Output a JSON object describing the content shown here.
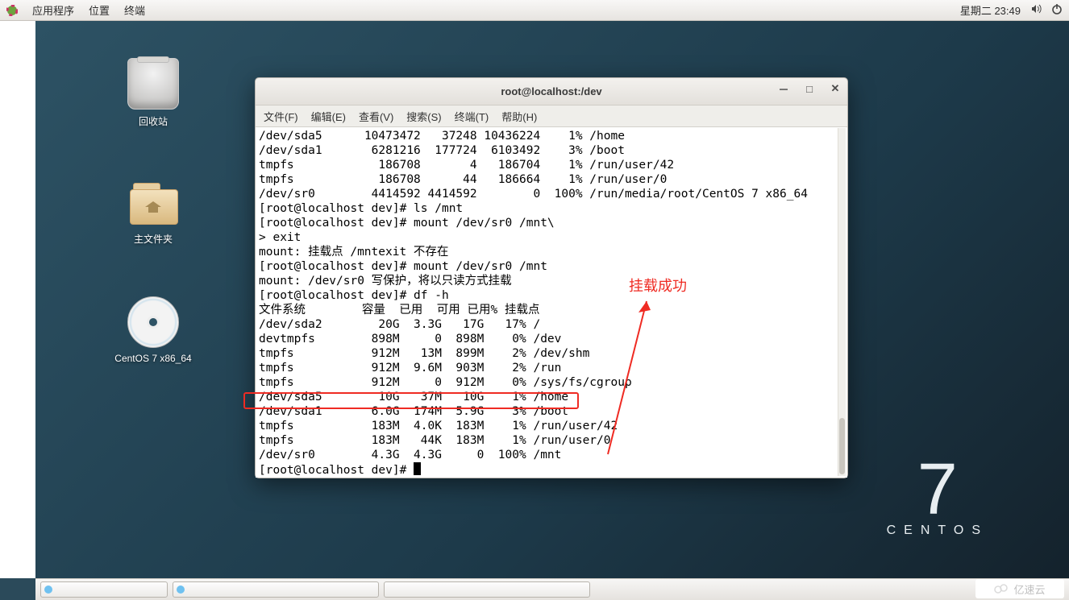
{
  "panel": {
    "apps": "应用程序",
    "places": "位置",
    "terminal": "终端",
    "clock": "星期二 23:49"
  },
  "desktop": {
    "trash": "回收站",
    "home": "主文件夹",
    "cd": "CentOS 7 x86_64"
  },
  "brand": {
    "num": "7",
    "word": "CENTOS"
  },
  "window": {
    "title": "root@localhost:/dev",
    "menu": {
      "file": "文件(F)",
      "edit": "编辑(E)",
      "view": "查看(V)",
      "search": "搜索(S)",
      "terminal": "终端(T)",
      "help": "帮助(H)"
    }
  },
  "terminal_lines": [
    "/dev/sda5      10473472   37248 10436224    1% /home",
    "/dev/sda1       6281216  177724  6103492    3% /boot",
    "tmpfs            186708       4   186704    1% /run/user/42",
    "tmpfs            186708      44   186664    1% /run/user/0",
    "/dev/sr0        4414592 4414592        0  100% /run/media/root/CentOS 7 x86_64",
    "[root@localhost dev]# ls /mnt",
    "[root@localhost dev]# mount /dev/sr0 /mnt\\",
    "> exit",
    "mount: 挂载点 /mntexit 不存在",
    "[root@localhost dev]# mount /dev/sr0 /mnt",
    "mount: /dev/sr0 写保护，将以只读方式挂载",
    "[root@localhost dev]# df -h",
    "文件系统        容量  已用  可用 已用% 挂载点",
    "/dev/sda2        20G  3.3G   17G   17% /",
    "devtmpfs        898M     0  898M    0% /dev",
    "tmpfs           912M   13M  899M    2% /dev/shm",
    "tmpfs           912M  9.6M  903M    2% /run",
    "tmpfs           912M     0  912M    0% /sys/fs/cgroup",
    "/dev/sda5        10G   37M   10G    1% /home",
    "/dev/sda1       6.0G  174M  5.9G    3% /boot",
    "tmpfs           183M  4.0K  183M    1% /run/user/42",
    "tmpfs           183M   44K  183M    1% /run/user/0",
    "/dev/sr0        4.3G  4.3G     0  100% /mnt",
    "[root@localhost dev]# "
  ],
  "annotation": {
    "label": "挂载成功"
  },
  "watermark": "亿速云"
}
